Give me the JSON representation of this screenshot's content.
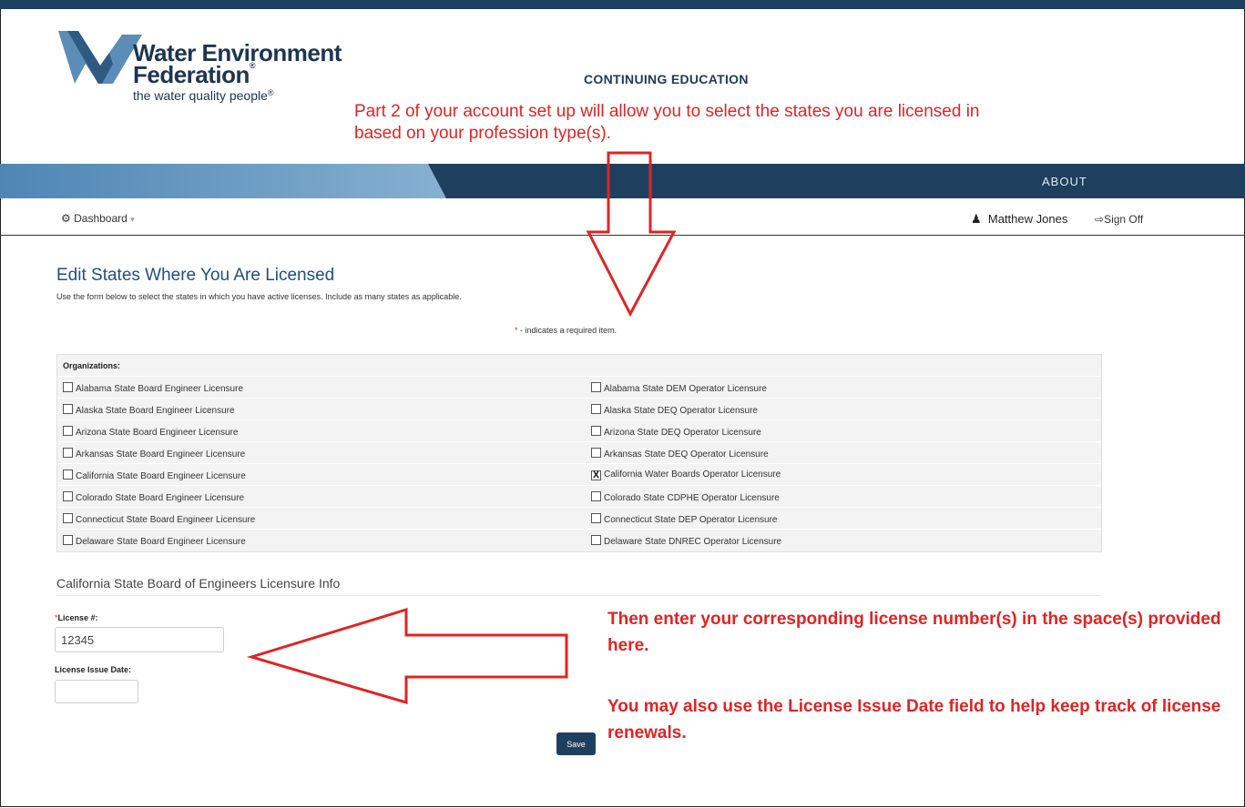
{
  "header": {
    "logo_line1": "Water Environment",
    "logo_line2": "Federation",
    "logo_tagline": "the water quality people",
    "section_title": "CONTINUING EDUCATION"
  },
  "annotations": {
    "top": "Part 2 of your account set up will allow you to select the states you are licensed in based on your profession type(s).",
    "right1": "Then enter your corresponding license number(s) in the space(s) provided here.",
    "right2": "You may also use the License Issue Date field to help keep track of license renewals.",
    "color": "#e02424"
  },
  "nav": {
    "about": "ABOUT",
    "dashboard": "Dashboard",
    "user_name": "Matthew Jones",
    "sign_off": "Sign Off"
  },
  "page": {
    "title": "Edit States Where You Are Licensed",
    "description": "Use the form below to select the states in which you have active licenses. Include as many states as applicable.",
    "required_note": "- indicates a required item."
  },
  "organizations": {
    "header": "Organizations:",
    "rows": [
      {
        "left": "Alabama State Board Engineer Licensure",
        "left_checked": false,
        "right": "Alabama State DEM Operator Licensure",
        "right_checked": false
      },
      {
        "left": "Alaska State Board Engineer Licensure",
        "left_checked": false,
        "right": "Alaska State DEQ Operator Licensure",
        "right_checked": false
      },
      {
        "left": "Arizona State Board Engineer Licensure",
        "left_checked": false,
        "right": "Arizona State DEQ Operator Licensure",
        "right_checked": false
      },
      {
        "left": "Arkansas State Board Engineer Licensure",
        "left_checked": false,
        "right": "Arkansas State DEQ Operator Licensure",
        "right_checked": false
      },
      {
        "left": "California State Board Engineer Licensure",
        "left_checked": false,
        "right": "California Water Boards Operator Licensure",
        "right_checked": true
      },
      {
        "left": "Colorado State Board Engineer Licensure",
        "left_checked": false,
        "right": "Colorado State CDPHE Operator Licensure",
        "right_checked": false
      },
      {
        "left": "Connecticut State Board Engineer Licensure",
        "left_checked": false,
        "right": "Connecticut State DEP Operator Licensure",
        "right_checked": false
      },
      {
        "left": "Delaware State Board Engineer Licensure",
        "left_checked": false,
        "right": "Delaware State DNREC Operator Licensure",
        "right_checked": false
      }
    ]
  },
  "license_info": {
    "section_title": "California State Board of Engineers Licensure Info",
    "license_label": "License #:",
    "license_value": "12345",
    "issue_date_label": "License Issue Date:",
    "issue_date_value": ""
  },
  "actions": {
    "save": "Save"
  },
  "icons": {
    "dashboard": "dashboard-icon",
    "user": "user-icon",
    "sign_off": "sign-off-icon",
    "caret": "caret-down-icon"
  },
  "colors": {
    "brand_dark": "#1e3f5e",
    "brand_light": "#6f9fc5",
    "title_blue": "#1f4f7f"
  }
}
